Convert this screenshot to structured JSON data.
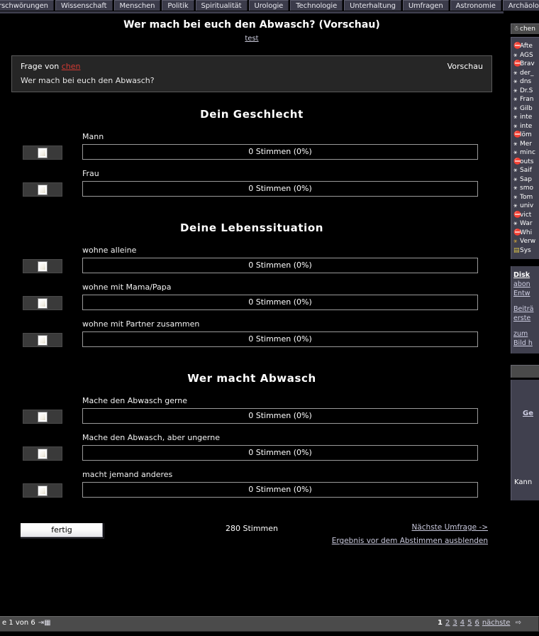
{
  "nav": {
    "tabs": [
      {
        "label": "Verschwörungen"
      },
      {
        "label": "Wissenschaft"
      },
      {
        "label": "Menschen"
      },
      {
        "label": "Politik"
      },
      {
        "label": "Spiritualität"
      },
      {
        "label": "Urologie"
      },
      {
        "label": "Technologie"
      },
      {
        "label": "Unterhaltung"
      },
      {
        "label": "Umfragen"
      },
      {
        "label": "Astronomie"
      },
      {
        "label": "Archäologie"
      }
    ]
  },
  "poll": {
    "title": "Wer mach bei euch den Abwasch? (Vorschau)",
    "subtitle_link": "test",
    "question_box": {
      "prefix": "Frage von",
      "author": "chen",
      "question": "Wer mach bei euch den Abwasch?",
      "preview_label": "Vorschau"
    },
    "sections": [
      {
        "title": "Dein Geschlecht",
        "options": [
          {
            "label": "Mann",
            "result": "0 Stimmen (0%)",
            "votes": 0,
            "percent": 0
          },
          {
            "label": "Frau",
            "result": "0 Stimmen (0%)",
            "votes": 0,
            "percent": 0
          }
        ]
      },
      {
        "title": "Deine Lebenssituation",
        "options": [
          {
            "label": "wohne alleine",
            "result": "0 Stimmen (0%)",
            "votes": 0,
            "percent": 0
          },
          {
            "label": "wohne mit Mama/Papa",
            "result": "0 Stimmen (0%)",
            "votes": 0,
            "percent": 0
          },
          {
            "label": "wohne mit Partner zusammen",
            "result": "0 Stimmen (0%)",
            "votes": 0,
            "percent": 0
          }
        ]
      },
      {
        "title": "Wer macht Abwasch",
        "options": [
          {
            "label": "Mache den Abwasch gerne",
            "result": "0 Stimmen (0%)",
            "votes": 0,
            "percent": 0
          },
          {
            "label": "Mache den Abwasch, aber ungerne",
            "result": "0 Stimmen (0%)",
            "votes": 0,
            "percent": 0
          },
          {
            "label": "macht jemand anderes",
            "result": "0 Stimmen (0%)",
            "votes": 0,
            "percent": 0
          }
        ]
      }
    ],
    "footer": {
      "submit_label": "fertig",
      "total_votes": "280 Stimmen",
      "next_poll_link": "Nächste Umfrage ->",
      "hide_results_link": "Ergebnis vor dem Abstimmen ausblenden"
    }
  },
  "sidebar": {
    "header_label": "chen",
    "users": [
      {
        "name": "Afte",
        "icon": "female-icon"
      },
      {
        "name": "AGS",
        "icon": "male-icon"
      },
      {
        "name": "Brav",
        "icon": "female-icon"
      },
      {
        "name": "der_",
        "icon": "male-icon"
      },
      {
        "name": "dns",
        "icon": "male-icon"
      },
      {
        "name": "Dr.S",
        "icon": "male-icon"
      },
      {
        "name": "Fran",
        "icon": "male-icon"
      },
      {
        "name": "Gilb",
        "icon": "male-icon"
      },
      {
        "name": "inte",
        "icon": "male-icon"
      },
      {
        "name": "inte",
        "icon": "male-icon"
      },
      {
        "name": "löm",
        "icon": "female-icon"
      },
      {
        "name": "Mer",
        "icon": "male-icon"
      },
      {
        "name": "minc",
        "icon": "male-icon"
      },
      {
        "name": "outs",
        "icon": "female-icon"
      },
      {
        "name": "Saif",
        "icon": "male-icon"
      },
      {
        "name": "Sap",
        "icon": "male-icon"
      },
      {
        "name": "smo",
        "icon": "male-icon"
      },
      {
        "name": "Tom",
        "icon": "male-icon"
      },
      {
        "name": "univ",
        "icon": "male-icon"
      },
      {
        "name": "vict",
        "icon": "female-icon"
      },
      {
        "name": "War",
        "icon": "male-icon"
      },
      {
        "name": "Whi",
        "icon": "female-icon"
      },
      {
        "name": "Verw",
        "icon": "guest-icon"
      },
      {
        "name": "Sys",
        "icon": "system-icon"
      }
    ],
    "links": [
      {
        "label": "Disk",
        "strong": true
      },
      {
        "label": "abon",
        "strong": false
      },
      {
        "label": "Entw",
        "strong": false
      },
      {
        "label": "Beiträ",
        "strong": false
      },
      {
        "label": "erste",
        "strong": false
      },
      {
        "label": "zum ",
        "strong": false
      },
      {
        "label": "Bild h",
        "strong": false
      }
    ],
    "panel2": {
      "link": "Ge",
      "text": "Kann"
    }
  },
  "statusbar": {
    "page_info": "e 1 von 6",
    "jump_icon": "jump-to-page-icon",
    "pages": [
      "1",
      "2",
      "3",
      "4",
      "5",
      "6"
    ],
    "current_page": "1",
    "next_label": "nächste",
    "next_icon": "arrow-right-icon"
  },
  "colors": {
    "background": "#000000",
    "nav_tab": "#3b3b4a",
    "panel": "#40404e",
    "author_link": "#d33a33",
    "link": "#cfcfe4",
    "bar_border": "#9a9a9a"
  }
}
